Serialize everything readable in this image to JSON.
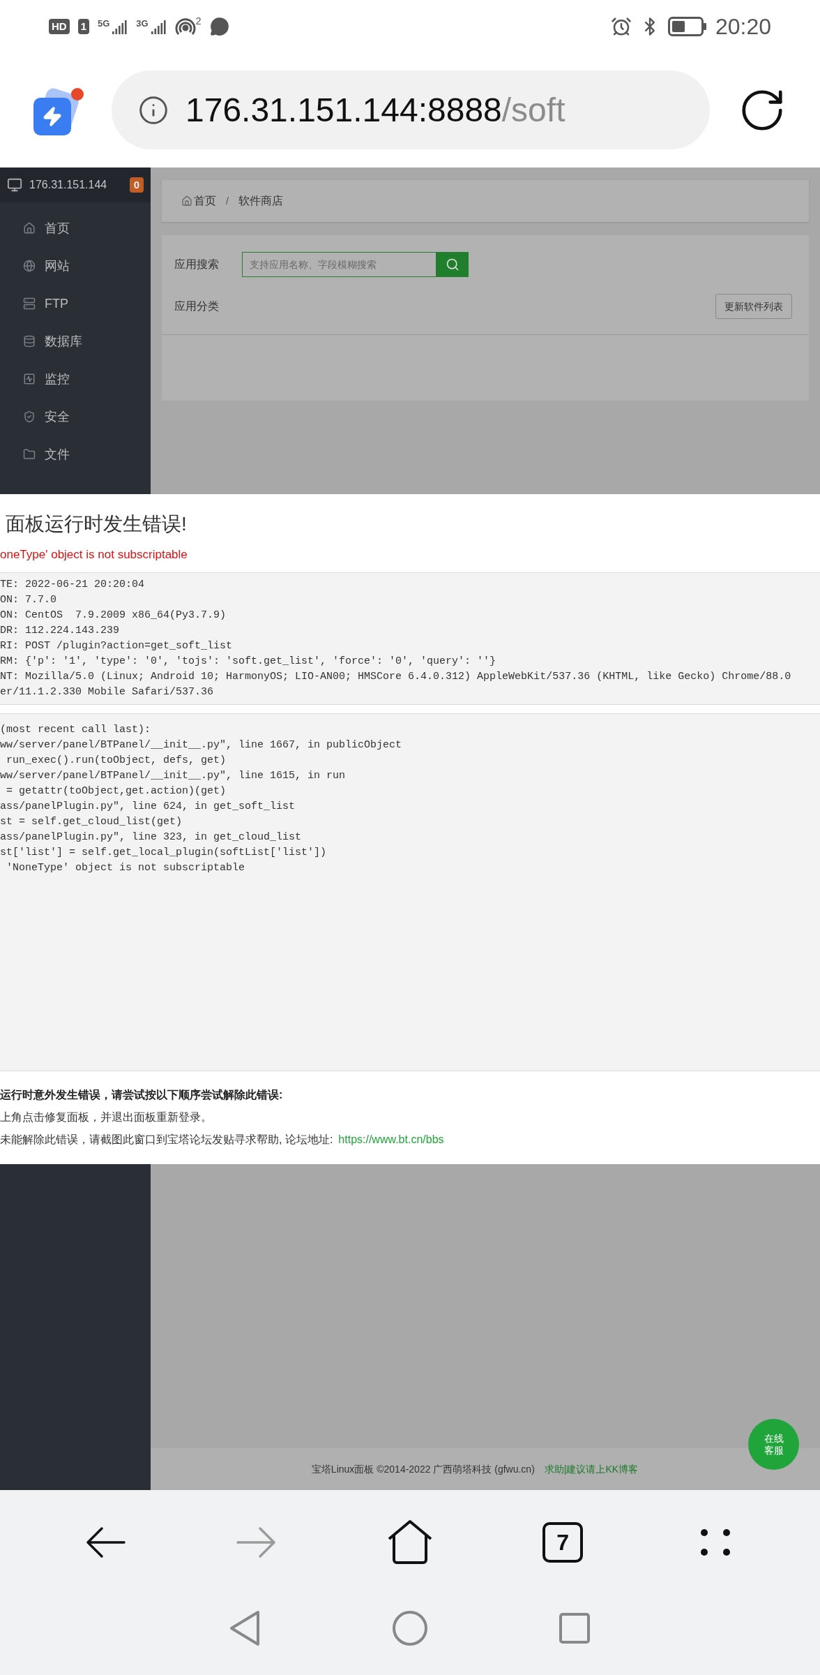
{
  "status_bar": {
    "indicators": [
      {
        "kind": "hd",
        "label": "HD"
      },
      {
        "kind": "sim",
        "label": "1"
      },
      {
        "kind": "signal",
        "label": "5G"
      },
      {
        "kind": "signal",
        "label": "3G"
      },
      {
        "kind": "hotspot",
        "label": "2"
      },
      {
        "kind": "chat"
      }
    ],
    "time": "20:20"
  },
  "address_bar": {
    "host": "176.31.151.144:8888",
    "path": "/soft",
    "notification_dot": true
  },
  "sidebar": {
    "server": "176.31.151.144",
    "badge": "0",
    "items": [
      {
        "kind": "home",
        "label": "首页"
      },
      {
        "kind": "globe",
        "label": "网站"
      },
      {
        "kind": "ftp",
        "label": "FTP"
      },
      {
        "kind": "database",
        "label": "数据库"
      },
      {
        "kind": "monitor",
        "label": "监控"
      },
      {
        "kind": "shield",
        "label": "安全"
      },
      {
        "kind": "folder",
        "label": "文件"
      }
    ]
  },
  "breadcrumb": [
    "首页",
    "/",
    "软件商店"
  ],
  "search": {
    "label": "应用搜索",
    "placeholder": "支持应用名称、字段模糊搜索"
  },
  "category": {
    "label": "应用分类",
    "button": "更新软件列表"
  },
  "error_dialog": {
    "title": "面板运行时发生错误!",
    "message": "oneType' object is not subscriptable",
    "environment": [
      "TE: 2022-06-21 20:20:04",
      "ON: 7.7.0",
      "ON: CentOS  7.9.2009 x86_64(Py3.7.9)",
      "DR: 112.224.143.239",
      "RI: POST /plugin?action=get_soft_list",
      "RM: {'p': '1', 'type': '0', 'tojs': 'soft.get_list', 'force': '0', 'query': ''}",
      "NT: Mozilla/5.0 (Linux; Android 10; HarmonyOS; LIO-AN00; HMSCore 6.4.0.312) AppleWebKit/537.36 (KHTML, like Gecko) Chrome/88.0",
      "er/11.1.2.330 Mobile Safari/537.36"
    ],
    "traceback": [
      "(most recent call last):",
      "ww/server/panel/BTPanel/__init__.py\", line 1667, in publicObject",
      " run_exec().run(toObject, defs, get)",
      "ww/server/panel/BTPanel/__init__.py\", line 1615, in run",
      " = getattr(toObject,get.action)(get)",
      "ass/panelPlugin.py\", line 624, in get_soft_list",
      "st = self.get_cloud_list(get)",
      "ass/panelPlugin.py\", line 323, in get_cloud_list",
      "st['list'] = self.get_local_plugin(softList['list'])",
      " 'NoneType' object is not subscriptable"
    ],
    "help_title": "运行时意外发生错误，请尝试按以下顺序尝试解除此错误:",
    "help_steps": [
      "上角点击修复面板，并退出面板重新登录。",
      "未能解除此错误，请截图此窗口到宝塔论坛发贴寻求帮助, 论坛地址:"
    ],
    "help_link": "https://www.bt.cn/bbs"
  },
  "footer": {
    "copyright": "宝塔Linux面板 ©2014-2022 广西萌塔科技 (gfwu.cn)",
    "link": "求助|建议请上KK博客"
  },
  "chat_button": [
    "在线",
    "客服"
  ],
  "browser_toolbar": [
    {
      "kind": "back",
      "disabled": false
    },
    {
      "kind": "forward",
      "disabled": true
    },
    {
      "kind": "home",
      "disabled": false
    },
    {
      "kind": "tabs",
      "label": "7",
      "disabled": false
    },
    {
      "kind": "menu",
      "disabled": false
    }
  ],
  "system_nav": [
    {
      "kind": "back"
    },
    {
      "kind": "home"
    },
    {
      "kind": "recents"
    }
  ]
}
